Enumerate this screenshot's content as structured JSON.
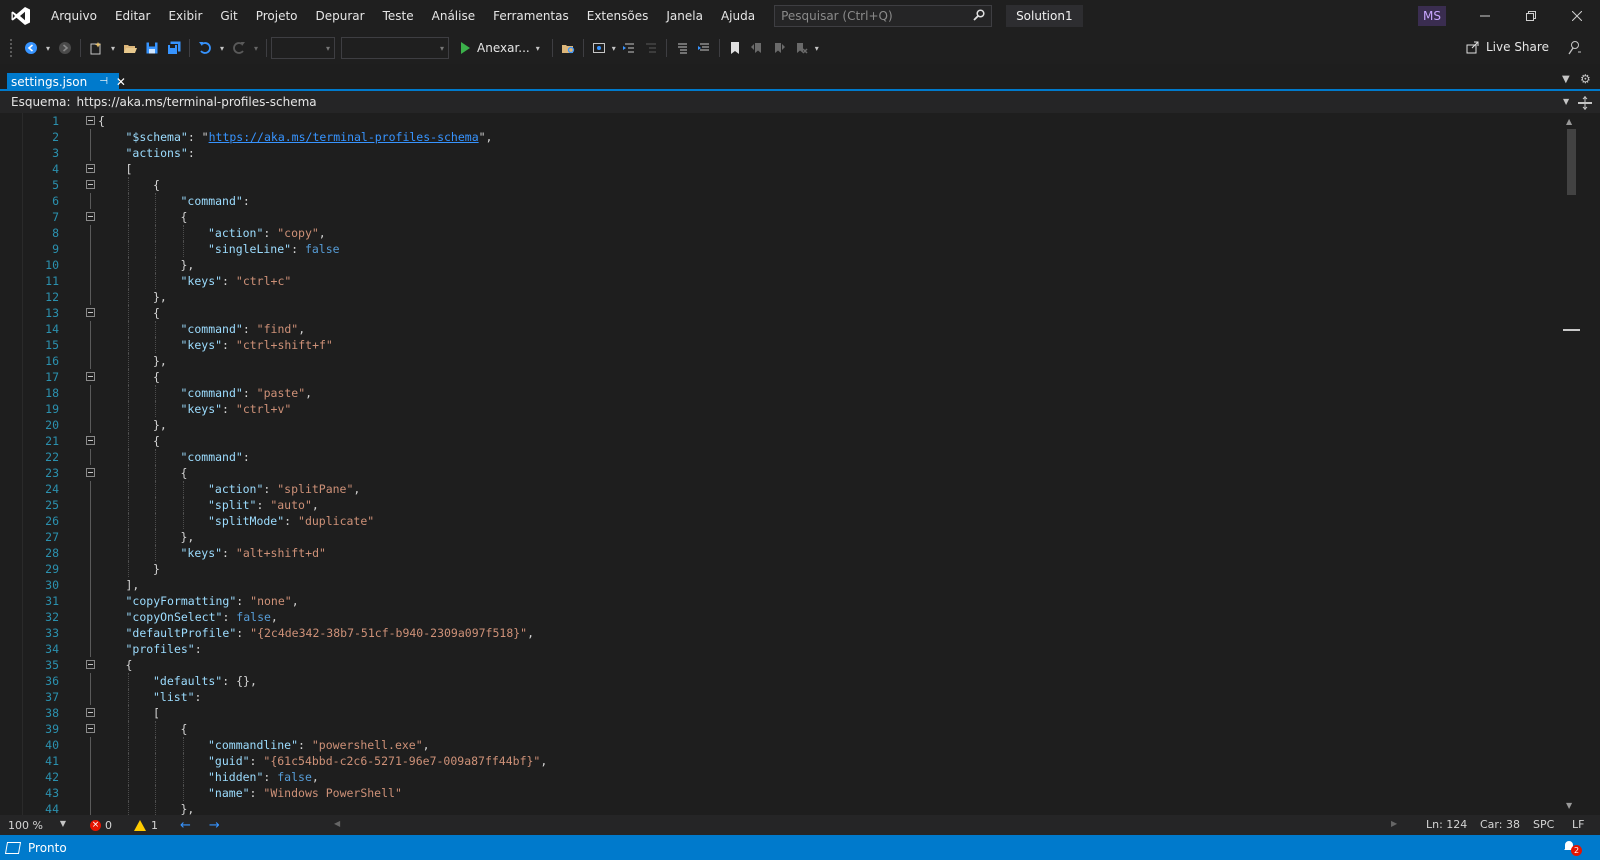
{
  "menu": {
    "items": [
      "Arquivo",
      "Editar",
      "Exibir",
      "Git",
      "Projeto",
      "Depurar",
      "Teste",
      "Análise",
      "Ferramentas",
      "Extensões",
      "Janela",
      "Ajuda"
    ]
  },
  "search": {
    "placeholder": "Pesquisar (Ctrl+Q)"
  },
  "solution_name": "Solution1",
  "user_initials": "MS",
  "toolbar": {
    "attach_label": "Anexar...",
    "live_share_label": "Live Share"
  },
  "tab": {
    "title": "settings.json",
    "pin_glyph": "⊣",
    "close_glyph": "✕"
  },
  "schema": {
    "label": "Esquema:",
    "value": "https://aka.ms/terminal-profiles-schema"
  },
  "editor": {
    "lines": [
      {
        "n": "1",
        "ind": 0,
        "fold": true,
        "t": [
          [
            "p",
            "{"
          ]
        ]
      },
      {
        "n": "2",
        "ind": 1,
        "t": [
          [
            "k",
            "\"$schema\""
          ],
          [
            "p",
            ": \""
          ],
          [
            "u",
            "https://aka.ms/terminal-profiles-schema"
          ],
          [
            "p",
            "\","
          ]
        ]
      },
      {
        "n": "3",
        "ind": 1,
        "t": [
          [
            "k",
            "\"actions\""
          ],
          [
            "p",
            ":"
          ]
        ]
      },
      {
        "n": "4",
        "ind": 1,
        "fold": true,
        "t": [
          [
            "p",
            "["
          ]
        ]
      },
      {
        "n": "5",
        "ind": 2,
        "fold": true,
        "t": [
          [
            "p",
            "{"
          ]
        ]
      },
      {
        "n": "6",
        "ind": 3,
        "t": [
          [
            "k",
            "\"command\""
          ],
          [
            "p",
            ":"
          ]
        ]
      },
      {
        "n": "7",
        "ind": 3,
        "fold": true,
        "t": [
          [
            "p",
            "{"
          ]
        ]
      },
      {
        "n": "8",
        "ind": 4,
        "t": [
          [
            "k",
            "\"action\""
          ],
          [
            "p",
            ": "
          ],
          [
            "s",
            "\"copy\""
          ],
          [
            "p",
            ","
          ]
        ]
      },
      {
        "n": "9",
        "ind": 4,
        "t": [
          [
            "k",
            "\"singleLine\""
          ],
          [
            "p",
            ": "
          ],
          [
            "b",
            "false"
          ]
        ]
      },
      {
        "n": "10",
        "ind": 3,
        "t": [
          [
            "p",
            "},"
          ]
        ]
      },
      {
        "n": "11",
        "ind": 3,
        "t": [
          [
            "k",
            "\"keys\""
          ],
          [
            "p",
            ": "
          ],
          [
            "s",
            "\"ctrl+c\""
          ]
        ]
      },
      {
        "n": "12",
        "ind": 2,
        "t": [
          [
            "p",
            "},"
          ]
        ]
      },
      {
        "n": "13",
        "ind": 2,
        "fold": true,
        "t": [
          [
            "p",
            "{"
          ]
        ]
      },
      {
        "n": "14",
        "ind": 3,
        "t": [
          [
            "k",
            "\"command\""
          ],
          [
            "p",
            ": "
          ],
          [
            "s",
            "\"find\""
          ],
          [
            "p",
            ","
          ]
        ]
      },
      {
        "n": "15",
        "ind": 3,
        "t": [
          [
            "k",
            "\"keys\""
          ],
          [
            "p",
            ": "
          ],
          [
            "s",
            "\"ctrl+shift+f\""
          ]
        ]
      },
      {
        "n": "16",
        "ind": 2,
        "t": [
          [
            "p",
            "},"
          ]
        ]
      },
      {
        "n": "17",
        "ind": 2,
        "fold": true,
        "t": [
          [
            "p",
            "{"
          ]
        ]
      },
      {
        "n": "18",
        "ind": 3,
        "t": [
          [
            "k",
            "\"command\""
          ],
          [
            "p",
            ": "
          ],
          [
            "s",
            "\"paste\""
          ],
          [
            "p",
            ","
          ]
        ]
      },
      {
        "n": "19",
        "ind": 3,
        "t": [
          [
            "k",
            "\"keys\""
          ],
          [
            "p",
            ": "
          ],
          [
            "s",
            "\"ctrl+v\""
          ]
        ]
      },
      {
        "n": "20",
        "ind": 2,
        "t": [
          [
            "p",
            "},"
          ]
        ]
      },
      {
        "n": "21",
        "ind": 2,
        "fold": true,
        "t": [
          [
            "p",
            "{"
          ]
        ]
      },
      {
        "n": "22",
        "ind": 3,
        "t": [
          [
            "k",
            "\"command\""
          ],
          [
            "p",
            ":"
          ]
        ]
      },
      {
        "n": "23",
        "ind": 3,
        "fold": true,
        "t": [
          [
            "p",
            "{"
          ]
        ]
      },
      {
        "n": "24",
        "ind": 4,
        "t": [
          [
            "k",
            "\"action\""
          ],
          [
            "p",
            ": "
          ],
          [
            "s",
            "\"splitPane\""
          ],
          [
            "p",
            ","
          ]
        ]
      },
      {
        "n": "25",
        "ind": 4,
        "t": [
          [
            "k",
            "\"split\""
          ],
          [
            "p",
            ": "
          ],
          [
            "s",
            "\"auto\""
          ],
          [
            "p",
            ","
          ]
        ]
      },
      {
        "n": "26",
        "ind": 4,
        "t": [
          [
            "k",
            "\"splitMode\""
          ],
          [
            "p",
            ": "
          ],
          [
            "s",
            "\"duplicate\""
          ]
        ]
      },
      {
        "n": "27",
        "ind": 3,
        "t": [
          [
            "p",
            "},"
          ]
        ]
      },
      {
        "n": "28",
        "ind": 3,
        "t": [
          [
            "k",
            "\"keys\""
          ],
          [
            "p",
            ": "
          ],
          [
            "s",
            "\"alt+shift+d\""
          ]
        ]
      },
      {
        "n": "29",
        "ind": 2,
        "t": [
          [
            "p",
            "}"
          ]
        ]
      },
      {
        "n": "30",
        "ind": 1,
        "t": [
          [
            "p",
            "],"
          ]
        ]
      },
      {
        "n": "31",
        "ind": 1,
        "t": [
          [
            "k",
            "\"copyFormatting\""
          ],
          [
            "p",
            ": "
          ],
          [
            "s",
            "\"none\""
          ],
          [
            "p",
            ","
          ]
        ]
      },
      {
        "n": "32",
        "ind": 1,
        "t": [
          [
            "k",
            "\"copyOnSelect\""
          ],
          [
            "p",
            ": "
          ],
          [
            "b",
            "false"
          ],
          [
            "p",
            ","
          ]
        ]
      },
      {
        "n": "33",
        "ind": 1,
        "t": [
          [
            "k",
            "\"defaultProfile\""
          ],
          [
            "p",
            ": "
          ],
          [
            "s",
            "\"{2c4de342-38b7-51cf-b940-2309a097f518}\""
          ],
          [
            "p",
            ","
          ]
        ]
      },
      {
        "n": "34",
        "ind": 1,
        "t": [
          [
            "k",
            "\"profiles\""
          ],
          [
            "p",
            ":"
          ]
        ]
      },
      {
        "n": "35",
        "ind": 1,
        "fold": true,
        "t": [
          [
            "p",
            "{"
          ]
        ]
      },
      {
        "n": "36",
        "ind": 2,
        "t": [
          [
            "k",
            "\"defaults\""
          ],
          [
            "p",
            ": {},"
          ]
        ]
      },
      {
        "n": "37",
        "ind": 2,
        "t": [
          [
            "k",
            "\"list\""
          ],
          [
            "p",
            ":"
          ]
        ]
      },
      {
        "n": "38",
        "ind": 2,
        "fold": true,
        "t": [
          [
            "p",
            "["
          ]
        ]
      },
      {
        "n": "39",
        "ind": 3,
        "fold": true,
        "t": [
          [
            "p",
            "{"
          ]
        ]
      },
      {
        "n": "40",
        "ind": 4,
        "t": [
          [
            "k",
            "\"commandline\""
          ],
          [
            "p",
            ": "
          ],
          [
            "s",
            "\"powershell.exe\""
          ],
          [
            "p",
            ","
          ]
        ]
      },
      {
        "n": "41",
        "ind": 4,
        "t": [
          [
            "k",
            "\"guid\""
          ],
          [
            "p",
            ": "
          ],
          [
            "s",
            "\"{61c54bbd-c2c6-5271-96e7-009a87ff44bf}\""
          ],
          [
            "p",
            ","
          ]
        ]
      },
      {
        "n": "42",
        "ind": 4,
        "t": [
          [
            "k",
            "\"hidden\""
          ],
          [
            "p",
            ": "
          ],
          [
            "b",
            "false"
          ],
          [
            "p",
            ","
          ]
        ]
      },
      {
        "n": "43",
        "ind": 4,
        "t": [
          [
            "k",
            "\"name\""
          ],
          [
            "p",
            ": "
          ],
          [
            "s",
            "\"Windows PowerShell\""
          ]
        ]
      },
      {
        "n": "44",
        "ind": 3,
        "t": [
          [
            "p",
            "},"
          ]
        ]
      }
    ]
  },
  "editor_status": {
    "zoom": "100 %",
    "errors": "0",
    "warnings": "1",
    "line": "Ln: 124",
    "col": "Car: 38",
    "spacing": "SPC",
    "eol": "LF"
  },
  "statusbar": {
    "ready": "Pronto",
    "notifications": "2"
  },
  "colors": {
    "accent": "#007acc",
    "keyword": "#9cdcfe",
    "string": "#ce9178",
    "link": "#3794ff",
    "boolean": "#569cd6",
    "line_number": "#2b91af"
  },
  "icons": [
    "vs-logo-icon",
    "search-icon",
    "back-icon",
    "forward-icon",
    "new-project-icon",
    "open-icon",
    "save-icon",
    "save-all-icon",
    "undo-icon",
    "redo-icon",
    "play-icon",
    "live-share-icon",
    "feedback-icon",
    "bookmark-icon",
    "pin-icon",
    "close-icon",
    "split-icon",
    "error-icon",
    "warning-icon",
    "notification-icon"
  ]
}
